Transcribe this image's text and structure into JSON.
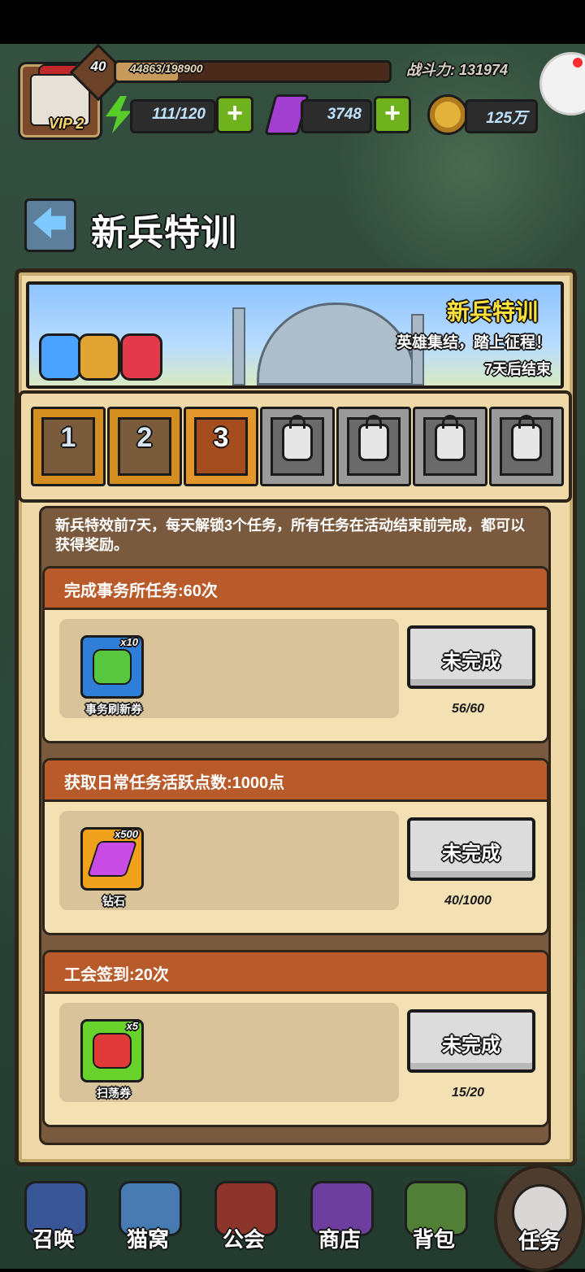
{
  "hud": {
    "level": "40",
    "xp_text": "44863/198900",
    "xp_fraction": 0.2256,
    "vip": "VIP 2",
    "power_text": "战斗力: 131974",
    "energy": "111/120",
    "gems": "3748",
    "coins": "125万"
  },
  "page": {
    "title": "新兵特训"
  },
  "banner": {
    "title": "新兵特训",
    "subtitle": "英雄集结，踏上征程！",
    "ends": "7天后结束"
  },
  "days": [
    {
      "label": "1",
      "state": "done"
    },
    {
      "label": "2",
      "state": "done"
    },
    {
      "label": "3",
      "state": "current"
    },
    {
      "state": "locked"
    },
    {
      "state": "locked"
    },
    {
      "state": "locked"
    },
    {
      "state": "locked"
    }
  ],
  "description": "新兵特效前7天，每天解锁3个任务，所有任务在活动结束前完成，都可以获得奖励。",
  "tasks": [
    {
      "title": "完成事务所任务:60次",
      "reward_qty": "x10",
      "reward_name": "事务刷新券",
      "button": "未完成",
      "progress": "56/60",
      "icon_color": "#59c640",
      "frame_color": "#2f7ed8"
    },
    {
      "title": "获取日常任务活跃点数:1000点",
      "reward_qty": "x500",
      "reward_name": "钻石",
      "button": "未完成",
      "progress": "40/1000",
      "icon_color": "#c84be6",
      "frame_color": "#f0a21c"
    },
    {
      "title": "工会签到:20次",
      "reward_qty": "x5",
      "reward_name": "扫荡券",
      "button": "未完成",
      "progress": "15/20",
      "icon_color": "#e13a3a",
      "frame_color": "#66d22b"
    }
  ],
  "bottom_nav": [
    {
      "label": "召唤"
    },
    {
      "label": "猫窝"
    },
    {
      "label": "公会"
    },
    {
      "label": "商店"
    },
    {
      "label": "背包"
    },
    {
      "label": "任务"
    }
  ]
}
